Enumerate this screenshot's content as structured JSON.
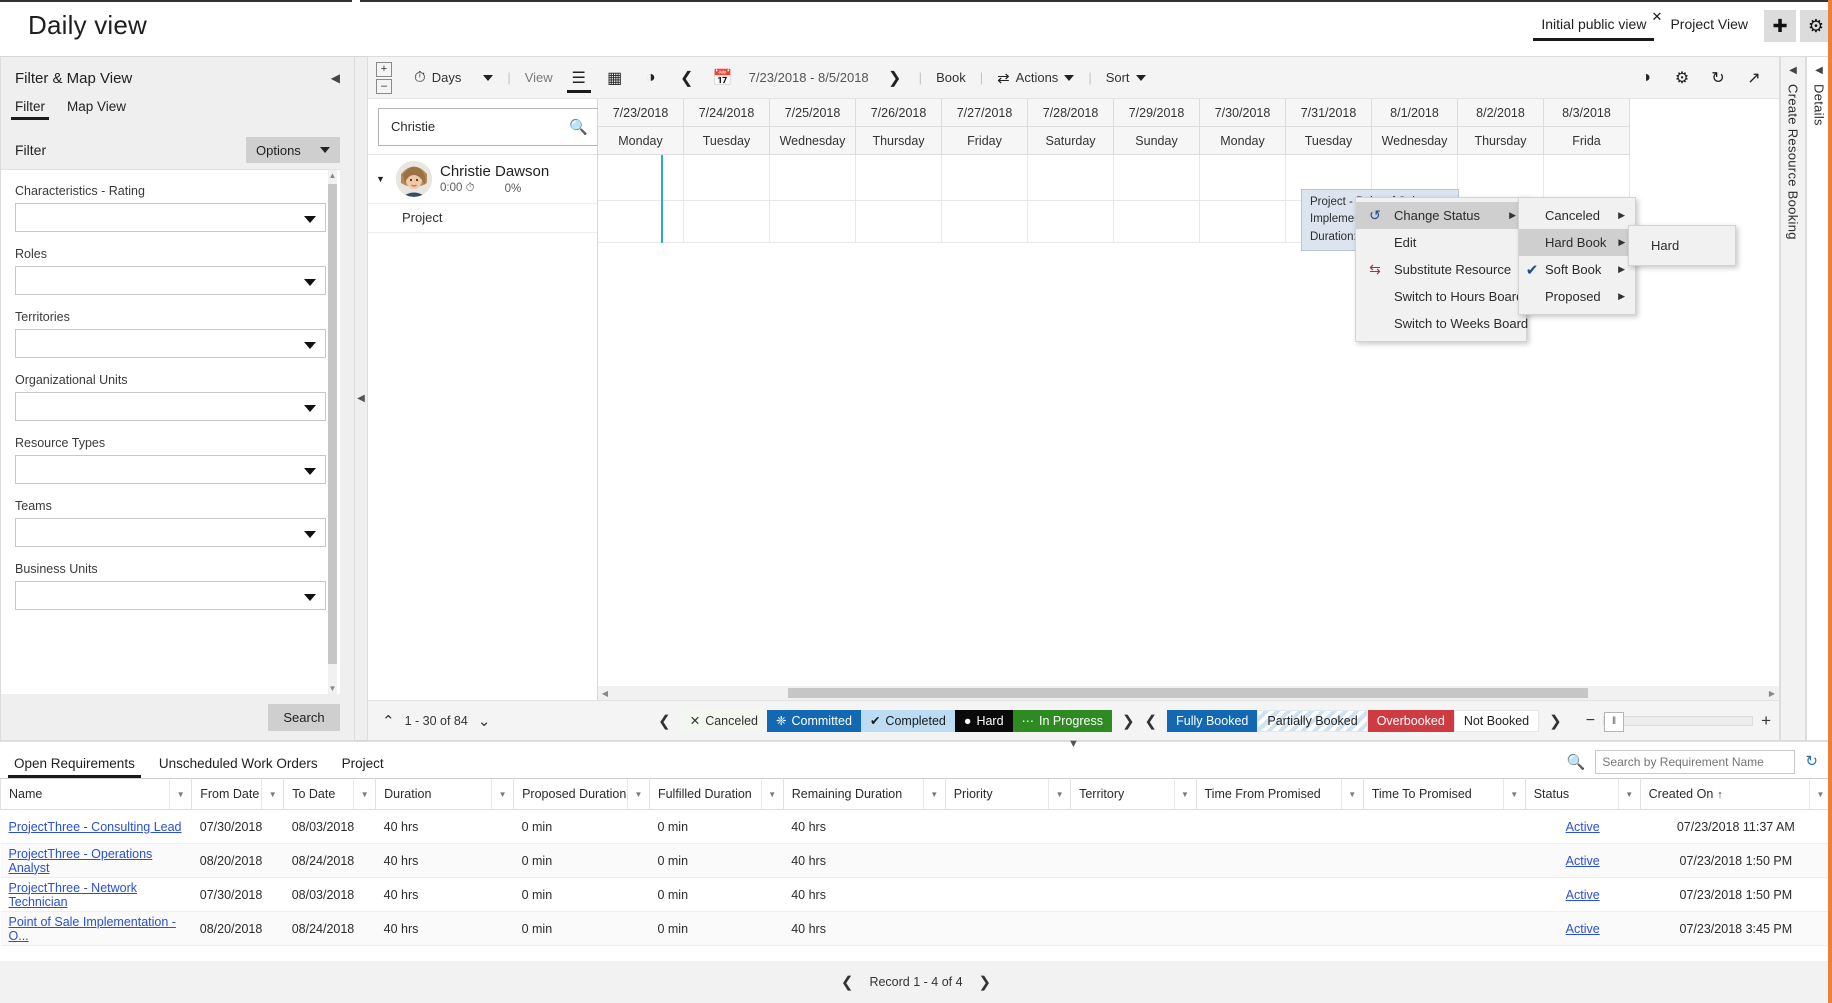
{
  "app": {
    "title": "Daily view",
    "view_tabs": [
      {
        "label": "Initial public view",
        "active": true,
        "closable": true
      },
      {
        "label": "Project View",
        "active": false,
        "closable": false
      }
    ],
    "add_tab_icon": "plus-icon",
    "settings_icon": "gear-icon"
  },
  "filter_panel": {
    "header": "Filter & Map View",
    "collapse_icon": "chevron-left-icon",
    "tabs": [
      {
        "label": "Filter",
        "active": true
      },
      {
        "label": "Map View",
        "active": false
      }
    ],
    "section_label": "Filter",
    "options_button": "Options",
    "fields": [
      {
        "label": "Characteristics - Rating",
        "value": ""
      },
      {
        "label": "Roles",
        "value": ""
      },
      {
        "label": "Territories",
        "value": ""
      },
      {
        "label": "Organizational Units",
        "value": ""
      },
      {
        "label": "Resource Types",
        "value": ""
      },
      {
        "label": "Teams",
        "value": ""
      },
      {
        "label": "Business Units",
        "value": ""
      }
    ],
    "search_button": "Search"
  },
  "scheduler": {
    "toolbar": {
      "zoom_in_icon": "plus-box-icon",
      "zoom_out_icon": "minus-box-icon",
      "scale_icon": "clock-icon",
      "scale_label": "Days",
      "view_label": "View",
      "view_modes": [
        {
          "name": "list-view",
          "icon": "list-icon",
          "active": true
        },
        {
          "name": "grid-view",
          "icon": "table-icon",
          "active": false
        },
        {
          "name": "map-view",
          "icon": "globe-icon",
          "active": false
        }
      ],
      "prev_icon": "chevron-left-icon",
      "calendar_icon": "calendar-icon",
      "date_range": "7/23/2018 - 8/5/2018",
      "next_icon": "chevron-right-icon",
      "book_label": "Book",
      "actions_label": "Actions",
      "actions_icon": "swap-icon",
      "sort_label": "Sort",
      "right_icons": [
        {
          "name": "eye-icon",
          "glyph": "◑"
        },
        {
          "name": "gear-icon",
          "glyph": "⚙"
        },
        {
          "name": "refresh-icon",
          "glyph": "↻"
        },
        {
          "name": "expand-icon",
          "glyph": "⤢"
        }
      ]
    },
    "resource_search": {
      "value": "Christie",
      "placeholder": "",
      "icon": "search-icon"
    },
    "resource": {
      "name": "Christie Dawson",
      "hours": "0:00",
      "hours_icon": "clock-icon",
      "utilization": "0%",
      "child_label": "Project",
      "expand_icon": "chevron-down-icon"
    },
    "columns": [
      {
        "date": "7/23/2018",
        "day": "Monday"
      },
      {
        "date": "7/24/2018",
        "day": "Tuesday"
      },
      {
        "date": "7/25/2018",
        "day": "Wednesday"
      },
      {
        "date": "7/26/2018",
        "day": "Thursday"
      },
      {
        "date": "7/27/2018",
        "day": "Friday"
      },
      {
        "date": "7/28/2018",
        "day": "Saturday"
      },
      {
        "date": "7/29/2018",
        "day": "Sunday"
      },
      {
        "date": "7/30/2018",
        "day": "Monday"
      },
      {
        "date": "7/31/2018",
        "day": "Tuesday"
      },
      {
        "date": "8/1/2018",
        "day": "Wednesday"
      },
      {
        "date": "8/2/2018",
        "day": "Thursday"
      },
      {
        "date": "8/3/2018",
        "day": "Frida"
      }
    ],
    "booking_tooltip": {
      "line1": "Project - Point of Sale Implemen",
      "line2": "Duration: 4"
    },
    "context_menu": {
      "items": [
        {
          "label": "Change Status",
          "icon": "change-status-icon",
          "submenu": true,
          "highlighted": true
        },
        {
          "label": "Edit",
          "icon": "",
          "submenu": false,
          "highlighted": false
        },
        {
          "label": "Substitute Resource",
          "icon": "substitute-icon",
          "submenu": true,
          "highlighted": false
        },
        {
          "label": "Switch to Hours Board",
          "icon": "",
          "submenu": false,
          "highlighted": false
        },
        {
          "label": "Switch to Weeks Board",
          "icon": "",
          "submenu": false,
          "highlighted": false
        }
      ]
    },
    "status_submenu": {
      "items": [
        {
          "label": "Canceled",
          "submenu": true,
          "checked": false,
          "highlighted": false
        },
        {
          "label": "Hard Book",
          "submenu": true,
          "checked": false,
          "highlighted": true
        },
        {
          "label": "Soft Book",
          "submenu": true,
          "checked": true,
          "highlighted": false
        },
        {
          "label": "Proposed",
          "submenu": true,
          "checked": false,
          "highlighted": false
        }
      ]
    },
    "hard_submenu": {
      "items": [
        {
          "label": "Hard"
        }
      ]
    },
    "status_bar": {
      "up_icon": "chevron-up-icon",
      "down_icon": "chevron-down-icon",
      "paging": "1 - 30 of 84",
      "prev_icon": "chevron-left-icon",
      "next_icon": "chevron-right-icon",
      "booking_legend": [
        {
          "label": "Canceled",
          "style": "cancel",
          "glyph": "✕"
        },
        {
          "label": "Committed",
          "style": "commit",
          "glyph": "◈"
        },
        {
          "label": "Completed",
          "style": "complete",
          "glyph": "✔"
        },
        {
          "label": "Hard",
          "style": "hard",
          "glyph": "●"
        },
        {
          "label": "In Progress",
          "style": "prog",
          "glyph": "⋯"
        }
      ],
      "utilization_legend": [
        {
          "label": "Fully Booked",
          "style": "full"
        },
        {
          "label": "Partially Booked",
          "style": "partial"
        },
        {
          "label": "Overbooked",
          "style": "over"
        },
        {
          "label": "Not Booked",
          "style": "notb"
        }
      ],
      "zoom_minus": "−",
      "zoom_plus": "+"
    },
    "rails": [
      {
        "label": "Create Resource Booking",
        "name": "create-resource-booking-rail"
      },
      {
        "label": "Details",
        "name": "details-rail"
      }
    ]
  },
  "bottom_panel": {
    "tabs": [
      {
        "label": "Open Requirements",
        "active": true
      },
      {
        "label": "Unscheduled Work Orders",
        "active": false
      },
      {
        "label": "Project",
        "active": false
      }
    ],
    "search": {
      "placeholder": "Search by Requirement Name",
      "icon": "search-icon"
    },
    "refresh_icon": "refresh-icon",
    "columns": [
      "Name",
      "From Date",
      "To Date",
      "Duration",
      "Proposed Duration",
      "Fulfilled Duration",
      "Remaining Duration",
      "Priority",
      "Territory",
      "Time From Promised",
      "Time To Promised",
      "Status",
      "Created On"
    ],
    "sort_column": "Created On",
    "sort_direction": "↑",
    "rows": [
      {
        "name": "ProjectThree - Consulting Lead",
        "from_date": "07/30/2018",
        "to_date": "08/03/2018",
        "duration": "40 hrs",
        "proposed_duration": "0 min",
        "fulfilled_duration": "0 min",
        "remaining_duration": "40 hrs",
        "priority": "",
        "territory": "",
        "time_from_promised": "",
        "time_to_promised": "",
        "status": "Active",
        "created_on": "07/23/2018 11:37 AM"
      },
      {
        "name": "ProjectThree - Operations Analyst",
        "from_date": "08/20/2018",
        "to_date": "08/24/2018",
        "duration": "40 hrs",
        "proposed_duration": "0 min",
        "fulfilled_duration": "0 min",
        "remaining_duration": "40 hrs",
        "priority": "",
        "territory": "",
        "time_from_promised": "",
        "time_to_promised": "",
        "status": "Active",
        "created_on": "07/23/2018 1:50 PM"
      },
      {
        "name": "ProjectThree - Network Technician",
        "from_date": "07/30/2018",
        "to_date": "08/03/2018",
        "duration": "40 hrs",
        "proposed_duration": "0 min",
        "fulfilled_duration": "0 min",
        "remaining_duration": "40 hrs",
        "priority": "",
        "territory": "",
        "time_from_promised": "",
        "time_to_promised": "",
        "status": "Active",
        "created_on": "07/23/2018 1:50 PM"
      },
      {
        "name": "Point of Sale Implementation - O...",
        "from_date": "08/20/2018",
        "to_date": "08/24/2018",
        "duration": "40 hrs",
        "proposed_duration": "0 min",
        "fulfilled_duration": "0 min",
        "remaining_duration": "40 hrs",
        "priority": "",
        "territory": "",
        "time_from_promised": "",
        "time_to_promised": "",
        "status": "Active",
        "created_on": "07/23/2018 3:45 PM"
      }
    ],
    "record_nav": {
      "prev_icon": "chevron-left-icon",
      "label": "Record 1 - 4 of 4",
      "next_icon": "chevron-right-icon"
    }
  },
  "colors": {
    "accent_blue": "#1268b3",
    "overbooked_red": "#cf3b43",
    "in_progress_green": "#2e8b22",
    "link_blue": "#2a4fd7",
    "now_line": "#2ca8e0",
    "edge_orange": "#e8823a"
  }
}
